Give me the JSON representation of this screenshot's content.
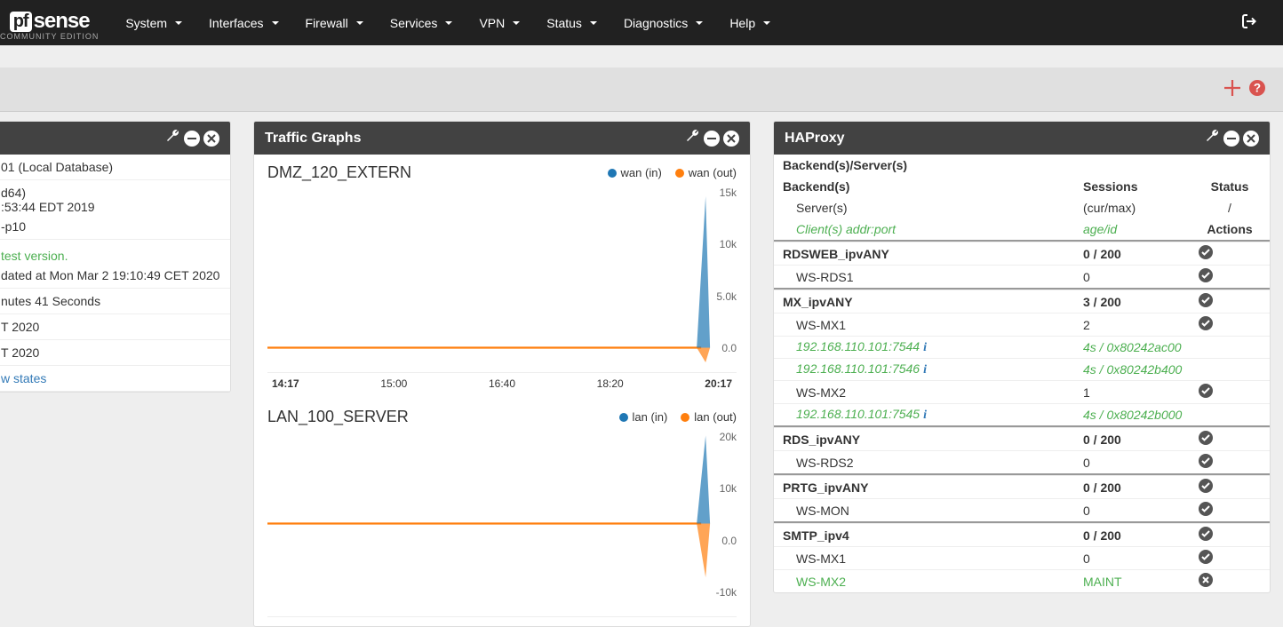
{
  "brand": {
    "pf": "pf",
    "sense": "sense",
    "edition": "COMMUNITY EDITION"
  },
  "nav": [
    "System",
    "Interfaces",
    "Firewall",
    "Services",
    "VPN",
    "Status",
    "Diagnostics",
    "Help"
  ],
  "sysinfo": {
    "rows": [
      "01 (Local Database)",
      "d64)",
      ":53:44 EDT 2019",
      "-p10"
    ],
    "latest": "test version.",
    "updated": "dated at Mon Mar 2 19:10:49 CET 2020",
    "uptime": "nutes 41 Seconds",
    "time1": "T 2020",
    "time2": "T 2020",
    "link": "w states"
  },
  "traffic": {
    "title": "Traffic Graphs",
    "graphs": [
      {
        "name": "DMZ_120_EXTERN",
        "legend": [
          {
            "label": "wan (in)",
            "color": "#1f77b4"
          },
          {
            "label": "wan (out)",
            "color": "#ff7f0e"
          }
        ],
        "yticks": [
          "15k",
          "10k",
          "5.0k",
          "0.0"
        ],
        "xticks": [
          "14:17",
          "15:00",
          "16:40",
          "18:20",
          "20:17"
        ]
      },
      {
        "name": "LAN_100_SERVER",
        "legend": [
          {
            "label": "lan (in)",
            "color": "#1f77b4"
          },
          {
            "label": "lan (out)",
            "color": "#ff7f0e"
          }
        ],
        "yticks": [
          "20k",
          "10k",
          "0.0",
          "-10k"
        ],
        "xticks": []
      }
    ]
  },
  "haproxy": {
    "title": "HAProxy",
    "head1": "Backend(s)/Server(s)",
    "head_backend": "Backend(s)",
    "head_sessions": "Sessions",
    "head_status": "Status",
    "head_server": "Server(s)",
    "head_curmax": "(cur/max)",
    "head_slash": "/",
    "head_client": "Client(s) addr:port",
    "head_ageid": "age/id",
    "head_actions": "Actions",
    "groups": [
      {
        "backend": {
          "name": "RDSWEB_ipvANY",
          "sess": "0 / 200",
          "status": "ok"
        },
        "rows": [
          {
            "type": "server",
            "name": "WS-RDS1",
            "sess": "0",
            "status": "ok"
          }
        ]
      },
      {
        "backend": {
          "name": "MX_ipvANY",
          "sess": "3 / 200",
          "status": "ok"
        },
        "rows": [
          {
            "type": "server",
            "name": "WS-MX1",
            "sess": "2",
            "status": "ok"
          },
          {
            "type": "client",
            "name": "192.168.110.101:7544",
            "sess": "4s / 0x80242ac00",
            "info": true
          },
          {
            "type": "client",
            "name": "192.168.110.101:7546",
            "sess": "4s / 0x80242b400",
            "info": true
          },
          {
            "type": "server",
            "name": "WS-MX2",
            "sess": "1",
            "status": "ok"
          },
          {
            "type": "client",
            "name": "192.168.110.101:7545",
            "sess": "4s / 0x80242b000",
            "info": true
          }
        ]
      },
      {
        "backend": {
          "name": "RDS_ipvANY",
          "sess": "0 / 200",
          "status": "ok"
        },
        "rows": [
          {
            "type": "server",
            "name": "WS-RDS2",
            "sess": "0",
            "status": "ok"
          }
        ]
      },
      {
        "backend": {
          "name": "PRTG_ipvANY",
          "sess": "0 / 200",
          "status": "ok"
        },
        "rows": [
          {
            "type": "server",
            "name": "WS-MON",
            "sess": "0",
            "status": "ok"
          }
        ]
      },
      {
        "backend": {
          "name": "SMTP_ipv4",
          "sess": "0 / 200",
          "status": "ok"
        },
        "rows": [
          {
            "type": "server",
            "name": "WS-MX1",
            "sess": "0",
            "status": "ok"
          },
          {
            "type": "maint",
            "name": "WS-MX2",
            "sess": "MAINT",
            "status": "x"
          }
        ]
      }
    ]
  },
  "chart_data": [
    {
      "type": "line",
      "title": "DMZ_120_EXTERN",
      "x_range": [
        "14:17",
        "20:17"
      ],
      "ylim": [
        0,
        16000
      ],
      "series": [
        {
          "name": "wan (in)",
          "color": "#1f77b4",
          "note": "flat ~0 until 20:17 spike to ~16k"
        },
        {
          "name": "wan (out)",
          "color": "#ff7f0e",
          "note": "flat ~0 with small negative dip near 20:17"
        }
      ],
      "xticks": [
        "14:17",
        "15:00",
        "16:40",
        "18:20",
        "20:17"
      ],
      "yticks": [
        0,
        5000,
        10000,
        15000
      ]
    },
    {
      "type": "line",
      "title": "LAN_100_SERVER",
      "x_range": [
        "14:17",
        "20:17"
      ],
      "ylim": [
        -12000,
        25000
      ],
      "series": [
        {
          "name": "lan (in)",
          "color": "#1f77b4",
          "note": "flat ~0 then spike to ~25k at right edge"
        },
        {
          "name": "lan (out)",
          "color": "#ff7f0e",
          "note": "flat ~0 then dip to ~-12k at right edge"
        }
      ],
      "yticks": [
        -10000,
        0,
        10000,
        20000
      ]
    }
  ]
}
